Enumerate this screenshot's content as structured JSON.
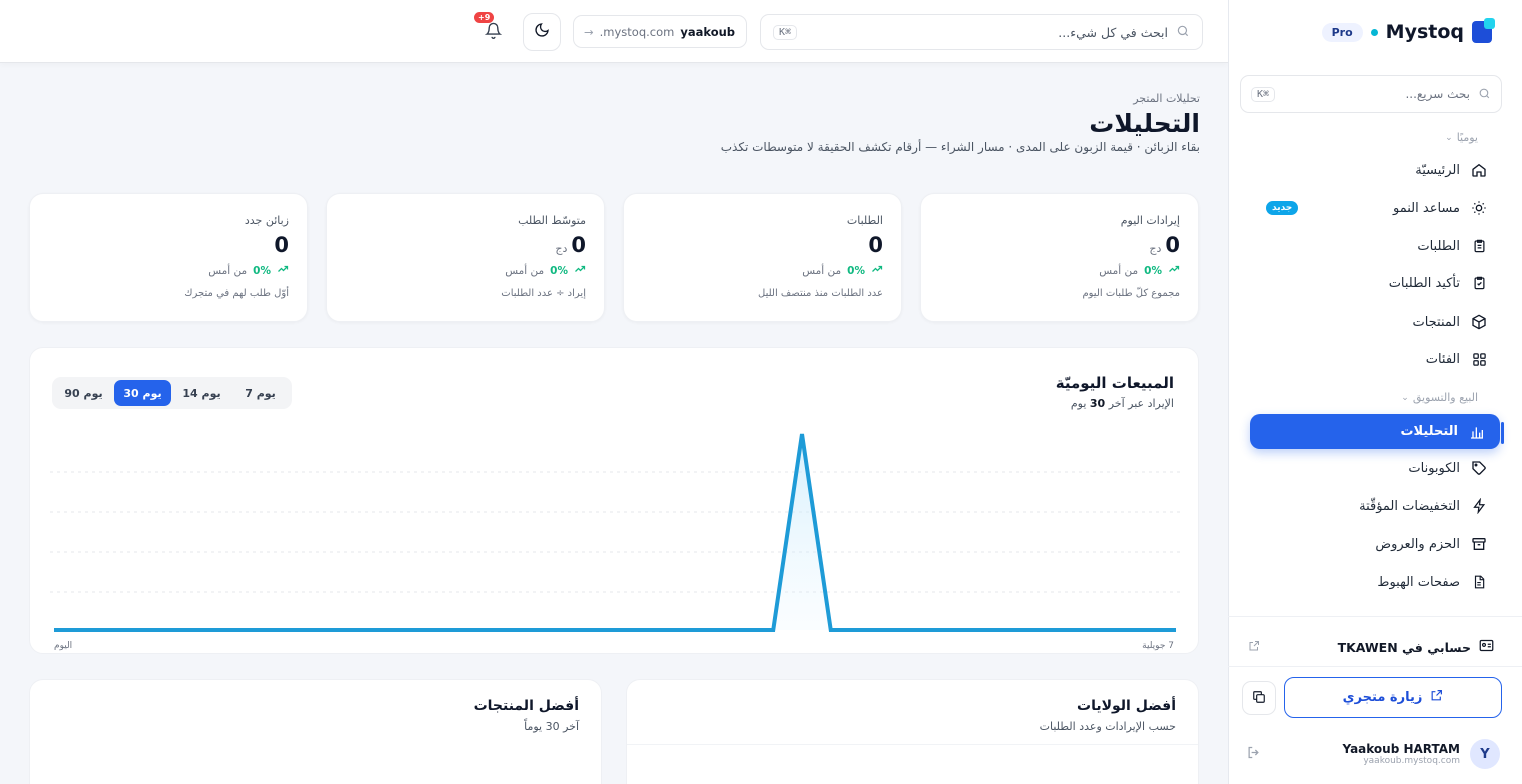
{
  "brand": {
    "name": "Mystoq",
    "plan": "Pro"
  },
  "sidebar": {
    "search_placeholder": "بحث سريع...",
    "search_shortcut": "⌘K",
    "sections": [
      {
        "label": "يوميًا"
      },
      {
        "label": "البيع والتسويق"
      }
    ],
    "items": [
      {
        "label": "الرئيسيّة",
        "icon": "home-icon"
      },
      {
        "label": "مساعد النمو",
        "icon": "lightbulb-icon",
        "badge": "جديد"
      },
      {
        "label": "الطلبات",
        "icon": "clipboard-icon"
      },
      {
        "label": "تأكيد الطلبات",
        "icon": "clipboard-check-icon"
      },
      {
        "label": "المنتجات",
        "icon": "box-icon"
      },
      {
        "label": "الفئات",
        "icon": "grid-icon"
      },
      {
        "label": "التحليلات",
        "icon": "bar-chart-icon",
        "active": true
      },
      {
        "label": "الكوبونات",
        "icon": "tag-icon"
      },
      {
        "label": "التخفيضات المؤقّتة",
        "icon": "lightning-icon"
      },
      {
        "label": "الحزم والعروض",
        "icon": "archive-icon"
      },
      {
        "label": "صفحات الهبوط",
        "icon": "file-icon"
      }
    ],
    "tkawen_label": "حسابي في TKAWEN",
    "visit_store_label": "زيارة متجري",
    "user": {
      "initial": "Y",
      "name": "Yaakoub HARTAM",
      "email": "yaakoub.mystoq.com"
    }
  },
  "topbar": {
    "search_placeholder": "ابحث في كل شيء...",
    "search_shortcut": "⌘K",
    "store_slug": "yaakoub",
    "store_domain": ".mystoq.com",
    "notifications_badge": "+9"
  },
  "header": {
    "breadcrumb": "تحليلات المتجر",
    "title": "التحليلات",
    "subtitle": "بقاء الزبائن · قيمة الزبون على المدى · مسار الشراء — أرقام تكشف الحقيقة لا متوسطات تكذب"
  },
  "kpis": [
    {
      "label": "إيرادات اليوم",
      "value": "0",
      "unit": "دج",
      "pct": "0%",
      "from": "من أمس",
      "note": "مجموع كلّ طلبات اليوم"
    },
    {
      "label": "الطلبات",
      "value": "0",
      "unit": "",
      "pct": "0%",
      "from": "من أمس",
      "note": "عدد الطلبات منذ منتصف الليل"
    },
    {
      "label": "متوسّط الطلب",
      "value": "0",
      "unit": "دج",
      "pct": "0%",
      "from": "من أمس",
      "note": "إيراد ÷ عدد الطلبات"
    },
    {
      "label": "زبائن جدد",
      "value": "0",
      "unit": "",
      "pct": "0%",
      "from": "من أمس",
      "note": "أوّل طلب لهم في متجرك"
    }
  ],
  "sales_chart": {
    "title": "المبيعات اليوميّة",
    "subtitle_prefix": "الإيراد عبر آخر",
    "subtitle_days": "30",
    "subtitle_suffix": "يوم",
    "ranges": [
      "7 يوم",
      "14 يوم",
      "30 يوم",
      "90 يوم"
    ],
    "active_range": "30 يوم",
    "x_start_label": "7 جويلية",
    "x_end_label": "اليوم"
  },
  "chart_data": {
    "type": "area",
    "title": "المبيعات اليوميّة",
    "x_start": "7 جويلية",
    "x_end": "اليوم",
    "points": 31,
    "values": [
      0,
      0,
      0,
      0,
      0,
      0,
      0,
      0,
      0,
      0,
      0,
      0,
      0,
      0,
      0,
      0,
      0,
      0,
      0,
      0,
      0,
      0,
      0,
      0,
      0,
      0,
      1,
      0,
      0,
      0,
      0,
      0,
      0,
      0,
      0,
      0,
      0,
      0,
      0,
      0
    ],
    "peak_index": 26,
    "grid": true,
    "line_color": "#1e9bd7"
  },
  "bottom_cards": {
    "states": {
      "title": "أفضل الولايات",
      "subtitle": "حسب الإيرادات وعدد الطلبات"
    },
    "products": {
      "title": "أفضل المنتجات",
      "subtitle": "آخر 30 يوماً"
    }
  },
  "colors": {
    "accent": "#2563eb",
    "success": "#10b981",
    "danger": "#ef4444"
  }
}
